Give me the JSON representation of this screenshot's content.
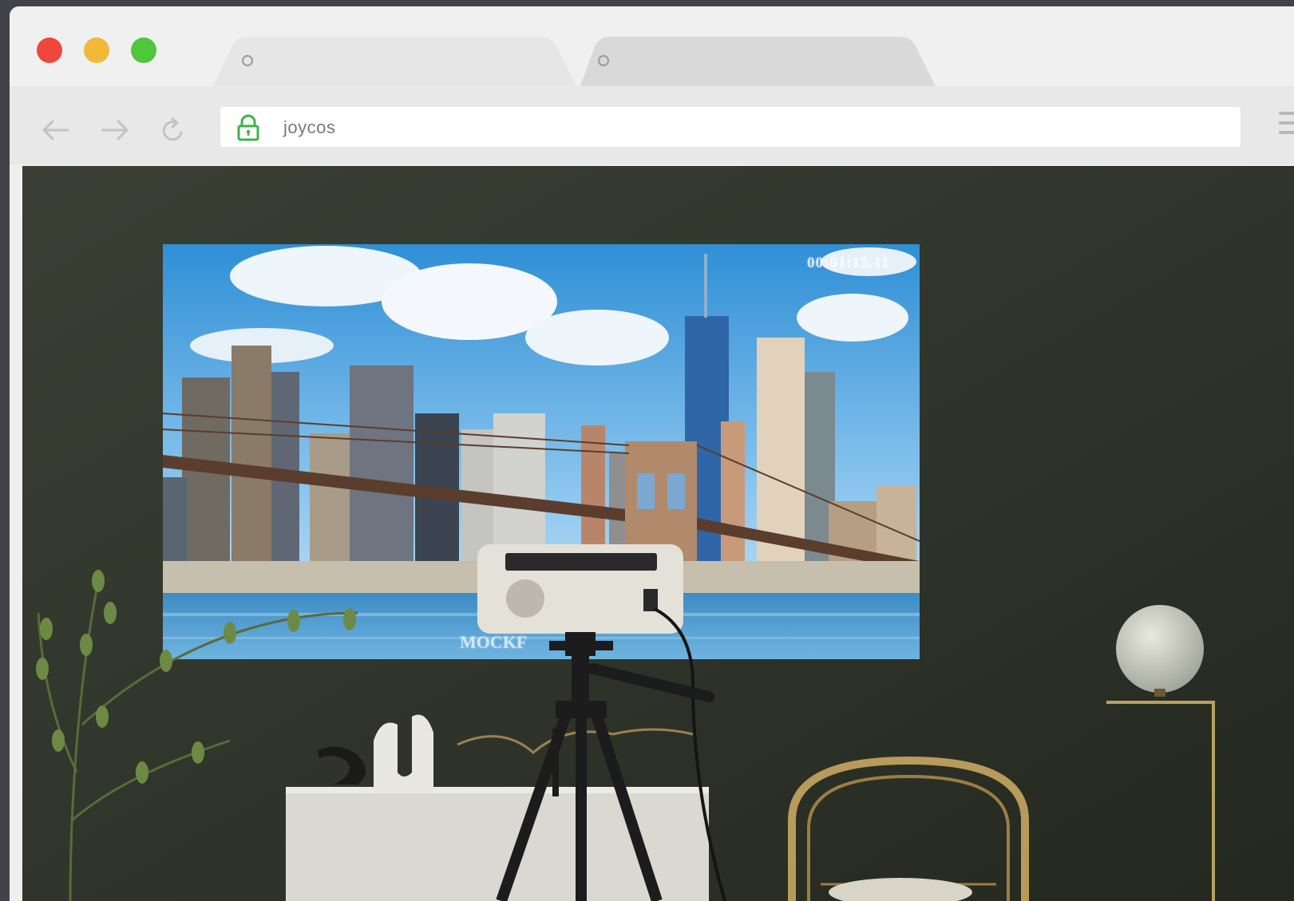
{
  "browser": {
    "tabs": [
      {
        "title": ""
      },
      {
        "title": ""
      }
    ],
    "address_bar": {
      "url": "joycos"
    },
    "icons": {
      "back": "arrow-left-icon",
      "forward": "arrow-right-icon",
      "reload": "reload-icon",
      "secure": "lock-icon",
      "menu": "hamburger-menu-icon"
    },
    "colors": {
      "close": "#f0473c",
      "minimize": "#f1b83a",
      "maximize": "#4fc63c",
      "lock": "#3ab54a"
    }
  },
  "page": {
    "projection": {
      "timestamp": "00:01:15.11",
      "watermark": "MOCKF"
    }
  }
}
